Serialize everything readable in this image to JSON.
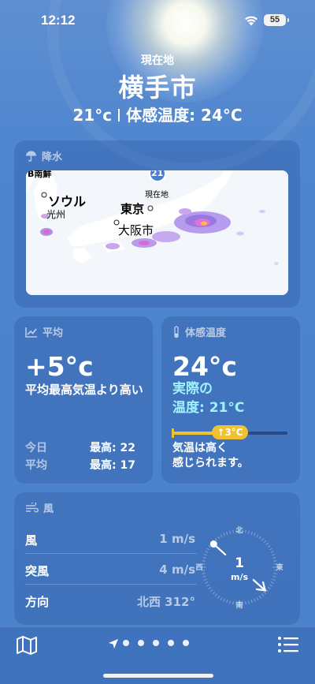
{
  "status_bar": {
    "time": "12:12",
    "battery": "55"
  },
  "header": {
    "location_label": "現在地",
    "city": "横手市",
    "current_temp": "21°c",
    "feels_like_text": "体感温度: 24°C"
  },
  "precipitation": {
    "title": "降水",
    "map_labels": {
      "cut_top": "B南鮮",
      "seoul": "ソウル",
      "gwangju": "光州",
      "tokyo": "東京",
      "osaka": "大阪市",
      "current_location": "現在地",
      "marker_temp": "21"
    }
  },
  "average": {
    "title": "平均",
    "value": "+5°c",
    "description": "平均最高気温より高い",
    "rows": [
      {
        "label": "今日",
        "value": "最高: 22"
      },
      {
        "label": "平均",
        "value": "最高: 17"
      }
    ]
  },
  "feels_like": {
    "title": "体感温度",
    "value": "24°c",
    "actual_line1": "実際の",
    "actual_line2": "温度: 21°C",
    "difference": "↑3°C",
    "note_line1": "気温は高く",
    "note_line2": "感じられます。"
  },
  "wind": {
    "title": "風",
    "rows": [
      {
        "label": "風",
        "value": "1 m/s"
      },
      {
        "label": "突風",
        "value": "4 m/s"
      },
      {
        "label": "方向",
        "value": "北西 312°"
      }
    ],
    "compass": {
      "north": "北",
      "east": "東",
      "south": "南",
      "west": "西",
      "speed": "1",
      "unit": "m/s",
      "direction_degrees": 312
    }
  },
  "tab_bar": {
    "page_count": 6,
    "current_page": 0
  }
}
